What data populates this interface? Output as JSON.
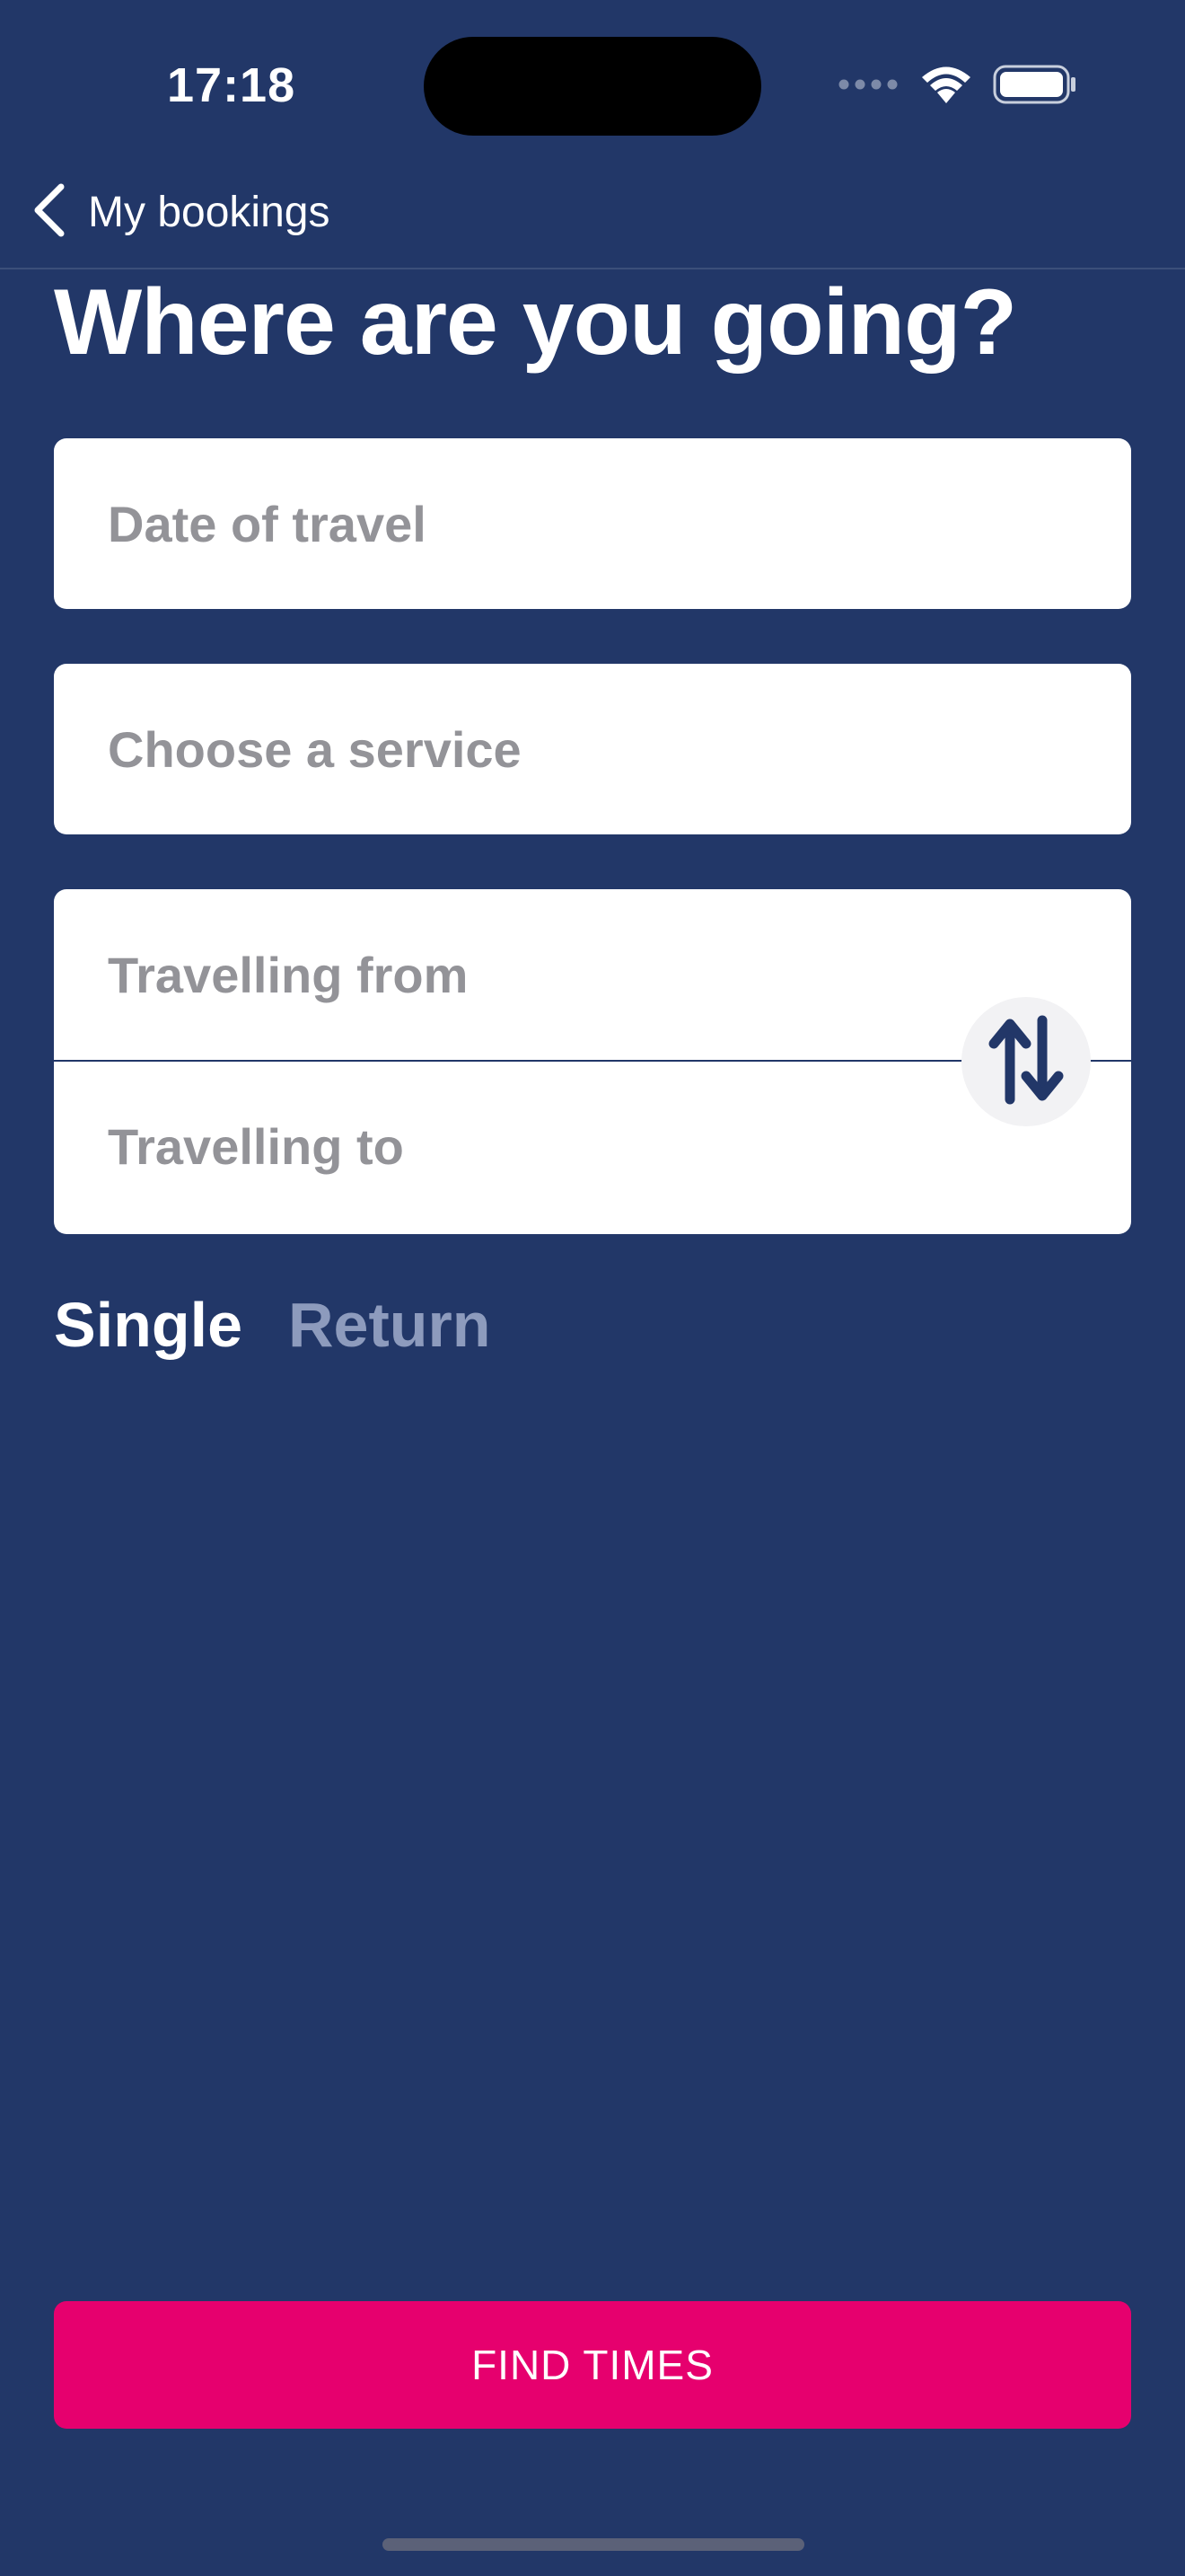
{
  "status_bar": {
    "time": "17:18",
    "icons": [
      "cellular-dots-icon",
      "wifi-icon",
      "battery-icon"
    ]
  },
  "nav": {
    "back_label": "My bookings",
    "back_icon": "chevron-left-icon"
  },
  "page": {
    "title": "Where are you going?"
  },
  "form": {
    "date_placeholder": "Date of travel",
    "service_placeholder": "Choose a service",
    "from_placeholder": "Travelling from",
    "to_placeholder": "Travelling to",
    "swap_icon": "swap-vertical-icon"
  },
  "trip_type": {
    "options": [
      "Single",
      "Return"
    ],
    "selected": "Single"
  },
  "actions": {
    "find_times_label": "FIND TIMES"
  },
  "colors": {
    "background": "#223768",
    "accent": "#e6006e",
    "field_bg": "#ffffff",
    "placeholder": "#8e8e93",
    "inactive_tab": "#8d9bbd"
  }
}
